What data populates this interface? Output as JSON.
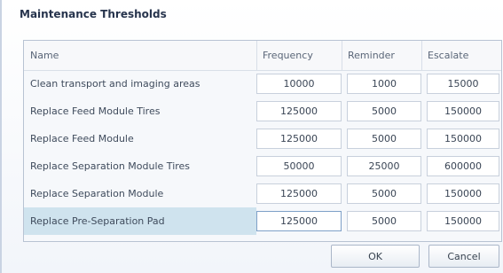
{
  "dialog": {
    "title": "Maintenance Thresholds",
    "headers": [
      "Name",
      "Frequency",
      "Reminder",
      "Escalate"
    ],
    "rows": [
      {
        "name": "Clean transport and imaging areas",
        "frequency": "10000",
        "reminder": "1000",
        "escalate": "15000"
      },
      {
        "name": "Replace Feed Module Tires",
        "frequency": "125000",
        "reminder": "5000",
        "escalate": "150000"
      },
      {
        "name": "Replace Feed Module",
        "frequency": "125000",
        "reminder": "5000",
        "escalate": "150000"
      },
      {
        "name": "Replace Separation Module Tires",
        "frequency": "50000",
        "reminder": "25000",
        "escalate": "600000"
      },
      {
        "name": "Replace Separation Module",
        "frequency": "125000",
        "reminder": "5000",
        "escalate": "150000"
      },
      {
        "name": "Replace Pre-Separation Pad",
        "frequency": "125000",
        "reminder": "5000",
        "escalate": "150000"
      }
    ],
    "selected_row": 5,
    "ok_label": "OK",
    "cancel_label": "Cancel"
  }
}
